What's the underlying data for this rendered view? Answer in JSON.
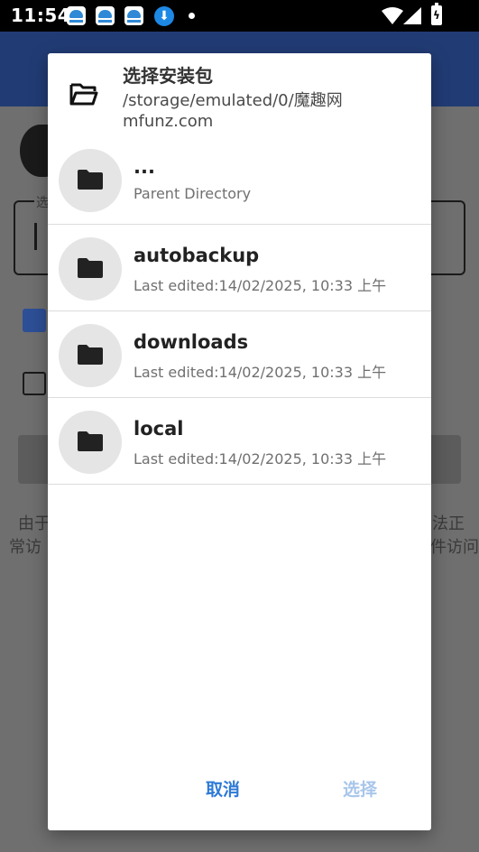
{
  "status_bar": {
    "time": "11:54"
  },
  "background": {
    "field_label": "选",
    "note_left_line1": "由于",
    "note_left_line2": "常访",
    "note_right_line1": "法正",
    "note_right_line2": "件访问"
  },
  "dialog": {
    "title": "选择安装包",
    "path": "/storage/emulated/0/魔趣网mfunz.com",
    "entries": [
      {
        "name": "...",
        "subtitle": "Parent Directory"
      },
      {
        "name": "autobackup",
        "subtitle": "Last edited:14/02/2025, 10:33 上午"
      },
      {
        "name": "downloads",
        "subtitle": "Last edited:14/02/2025, 10:33 上午"
      },
      {
        "name": "local",
        "subtitle": "Last edited:14/02/2025, 10:33 上午"
      }
    ],
    "cancel_label": "取消",
    "select_label": "选择"
  },
  "colors": {
    "accent": "#2d7ad6",
    "disabled_accent": "#a8c6ea",
    "appbar": "#213c75"
  },
  "icons": [
    "open-folder-icon",
    "folder-icon",
    "download-icon",
    "wifi-icon",
    "cell-signal-icon",
    "battery-icon"
  ]
}
